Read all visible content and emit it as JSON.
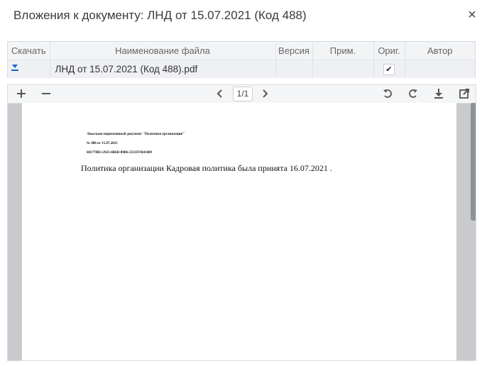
{
  "dialog": {
    "title": "Вложения к документу: ЛНД от 15.07.2021 (Код 488)",
    "close_symbol": "×"
  },
  "grid": {
    "columns": [
      "Скачать",
      "Наименование файла",
      "Версия",
      "Прим.",
      "Ориг.",
      "Автор"
    ],
    "rows": [
      {
        "download_icon": "download-icon",
        "file_name": "ЛНД от 15.07.2021 (Код 488).pdf",
        "version": "",
        "note": "",
        "original_checked": true,
        "original_mark": "✔",
        "author": ""
      }
    ]
  },
  "viewer": {
    "toolbar": {
      "zoom_in_icon": "plus-icon",
      "zoom_out_icon": "minus-icon",
      "prev_icon": "chevron-left-icon",
      "page_indicator": "1/1",
      "next_icon": "chevron-right-icon",
      "rotate_ccw_icon": "rotate-left-icon",
      "rotate_cw_icon": "rotate-right-icon",
      "download_icon": "download-icon",
      "open_new_icon": "open-external-icon"
    },
    "pdf": {
      "header_line1": "Локально-нормативный документ \"Политики организации\"",
      "header_line2": "№ 488 от 15.07.2021",
      "header_line3": "681770B3-2923-4B6D-89B6-2511FFB41489",
      "body_text": "Политика организации Кадровая политика была принята 16.07.2021 ."
    }
  },
  "colors": {
    "accent": "#1565c0",
    "viewer_bg": "#c8cacd",
    "grid_header_bg": "#f3f4f6",
    "row_bg": "#eef0f3"
  }
}
